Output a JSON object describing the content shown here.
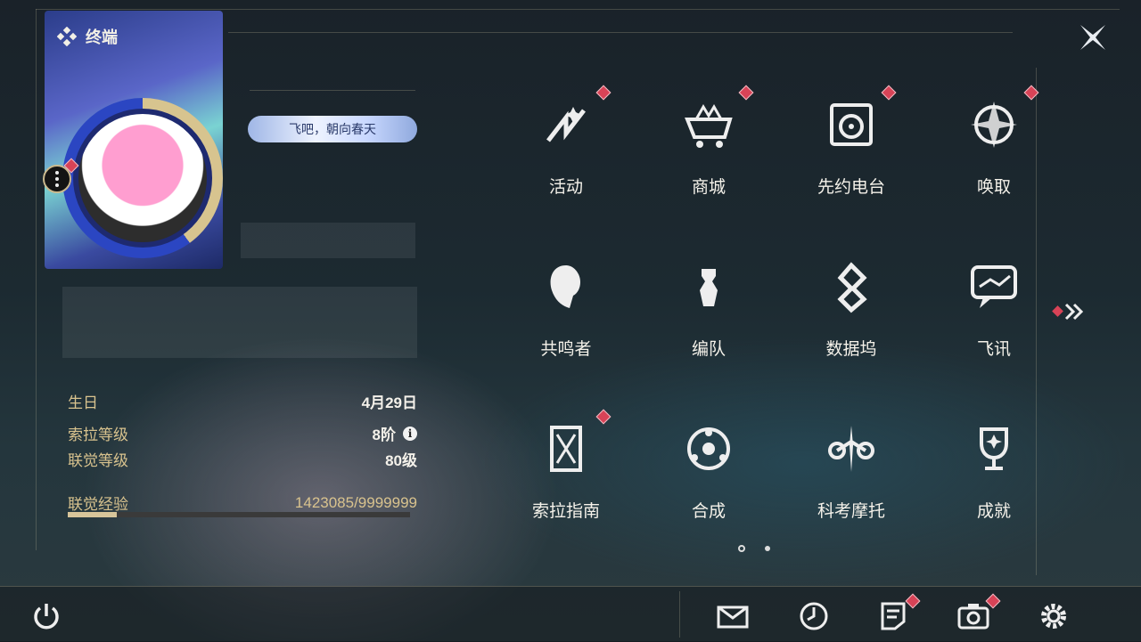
{
  "header": {
    "title": "终端",
    "title_icon": "diamond-grid-icon",
    "close_icon": "close-icon"
  },
  "profile": {
    "signature": "飞吧，朝向春天",
    "stats": [
      {
        "label": "生日",
        "value": "4月29日"
      },
      {
        "label": "索拉等级",
        "value": "8阶",
        "has_info": true
      },
      {
        "label": "联觉等级",
        "value": "80级"
      }
    ],
    "exp": {
      "label": "联觉经验",
      "value": "1423085/9999999",
      "fraction": 0.142
    }
  },
  "menu": [
    {
      "label": "活动",
      "icon": "activity-icon",
      "badge": true
    },
    {
      "label": "商城",
      "icon": "shop-cart-icon",
      "badge": true
    },
    {
      "label": "先约电台",
      "icon": "radio-icon",
      "badge": true
    },
    {
      "label": "唤取",
      "icon": "convene-compass-icon",
      "badge": true
    },
    {
      "label": "共鸣者",
      "icon": "resonator-icon",
      "badge": false
    },
    {
      "label": "编队",
      "icon": "team-chess-icon",
      "badge": false
    },
    {
      "label": "数据坞",
      "icon": "data-bank-icon",
      "badge": false
    },
    {
      "label": "飞讯",
      "icon": "chat-icon",
      "badge": false
    },
    {
      "label": "索拉指南",
      "icon": "guidebook-icon",
      "badge": true
    },
    {
      "label": "合成",
      "icon": "synthesis-icon",
      "badge": false
    },
    {
      "label": "科考摩托",
      "icon": "motorbike-icon",
      "badge": false
    },
    {
      "label": "成就",
      "icon": "trophy-icon",
      "badge": false
    }
  ],
  "pagination": {
    "current": 1,
    "total": 2
  },
  "bottom": {
    "power_icon": "power-icon",
    "buttons": [
      {
        "icon": "mail-icon",
        "badge": false
      },
      {
        "icon": "clock-icon",
        "badge": false
      },
      {
        "icon": "notice-icon",
        "badge": true
      },
      {
        "icon": "camera-icon",
        "badge": true
      },
      {
        "icon": "settings-gear-icon",
        "badge": false
      }
    ]
  },
  "colors": {
    "accent_gold": "#d9c38e",
    "badge_red": "#d84357"
  }
}
